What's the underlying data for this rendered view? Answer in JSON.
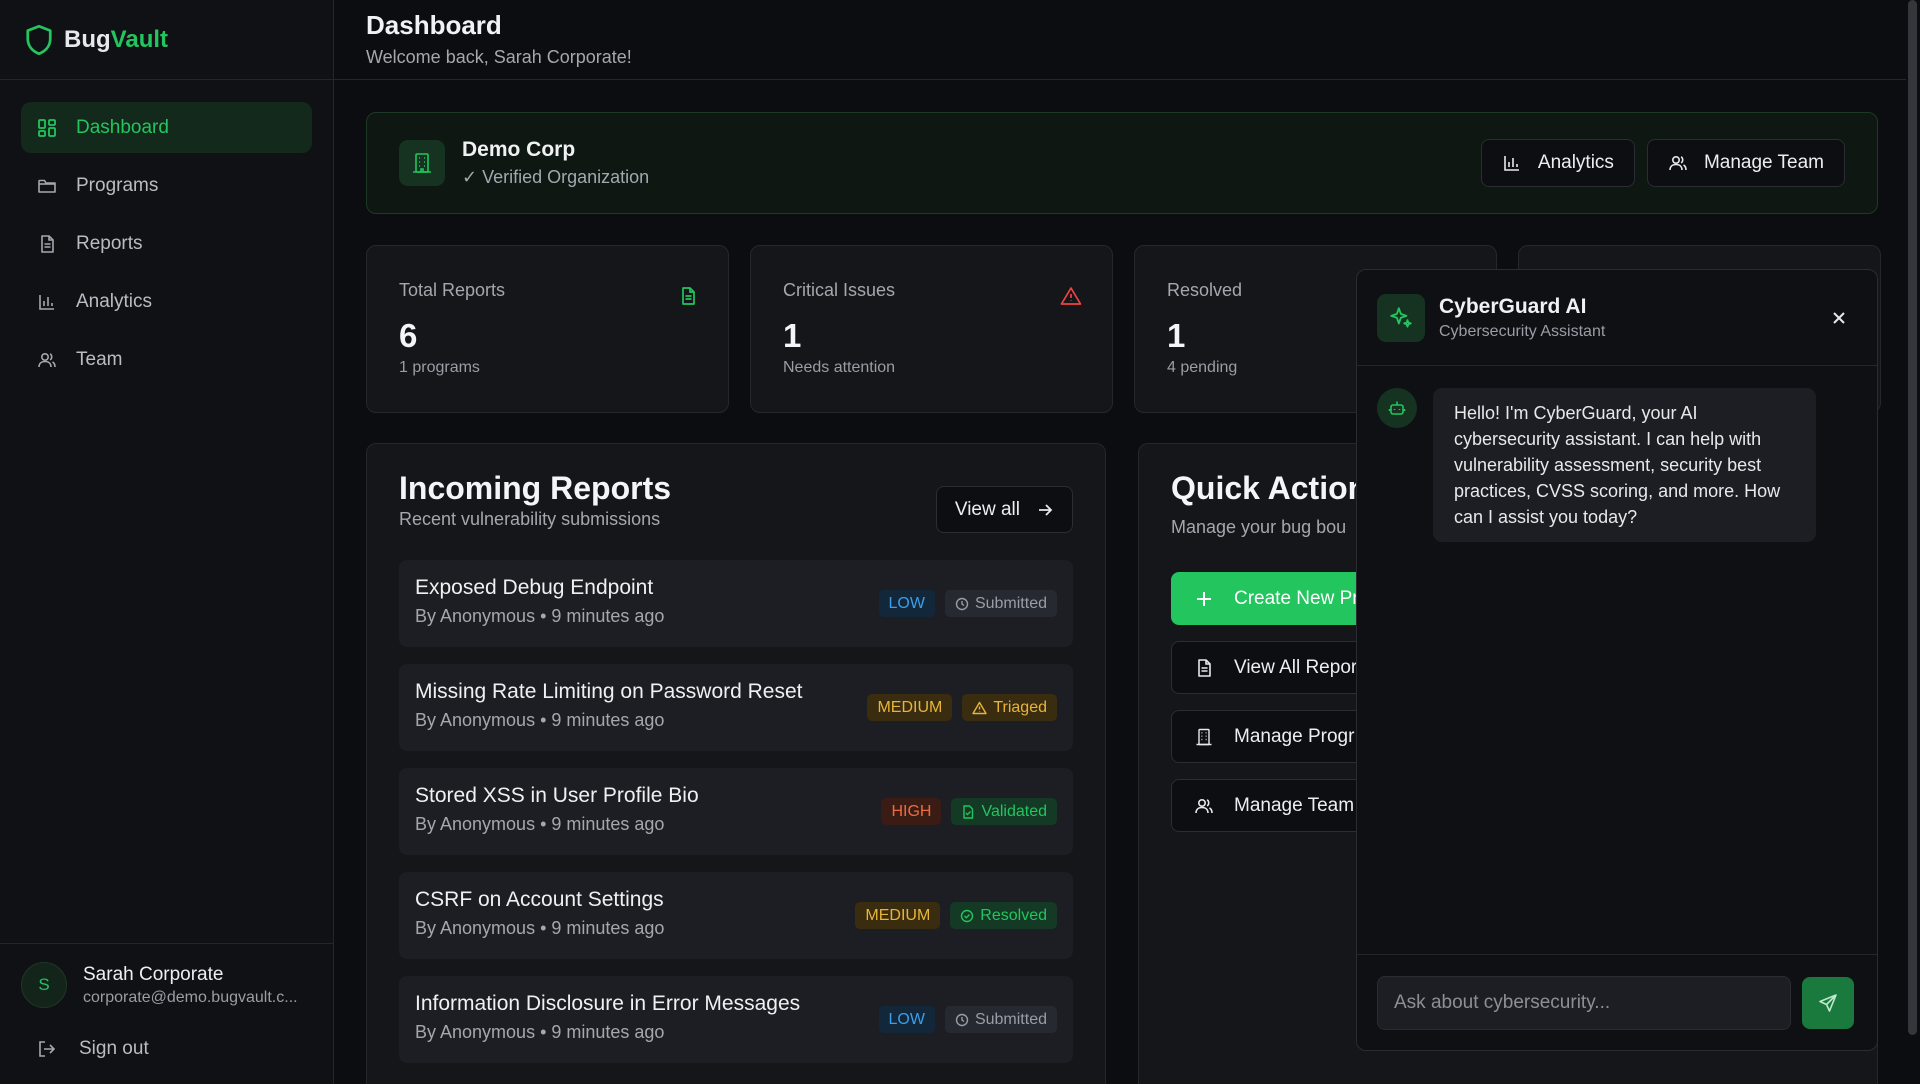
{
  "brand": {
    "part1": "Bug",
    "part2": "Vault"
  },
  "sidebar": {
    "items": [
      {
        "label": "Dashboard",
        "icon": "dashboard-icon"
      },
      {
        "label": "Programs",
        "icon": "folder-icon"
      },
      {
        "label": "Reports",
        "icon": "file-icon"
      },
      {
        "label": "Analytics",
        "icon": "bar-chart-icon"
      },
      {
        "label": "Team",
        "icon": "users-icon"
      }
    ],
    "user": {
      "initial": "S",
      "name": "Sarah Corporate",
      "email": "corporate@demo.bugvault.c..."
    },
    "signout": "Sign out"
  },
  "header": {
    "title": "Dashboard",
    "subtitle": "Welcome back, Sarah Corporate!"
  },
  "org": {
    "name": "Demo Corp",
    "verified": "✓ Verified Organization",
    "analytics_label": "Analytics",
    "manage_team_label": "Manage Team"
  },
  "stats": [
    {
      "label": "Total Reports",
      "value": "6",
      "sub": "1 programs"
    },
    {
      "label": "Critical Issues",
      "value": "1",
      "sub": "Needs attention"
    },
    {
      "label": "Resolved",
      "value": "1",
      "sub": "4 pending"
    }
  ],
  "reports": {
    "title": "Incoming Reports",
    "subtitle": "Recent vulnerability submissions",
    "view_all": "View all",
    "items": [
      {
        "title": "Exposed Debug Endpoint",
        "meta": "By Anonymous • 9 minutes ago",
        "severity": "LOW",
        "status": "Submitted"
      },
      {
        "title": "Missing Rate Limiting on Password Reset",
        "meta": "By Anonymous • 9 minutes ago",
        "severity": "MEDIUM",
        "status": "Triaged"
      },
      {
        "title": "Stored XSS in User Profile Bio",
        "meta": "By Anonymous • 9 minutes ago",
        "severity": "HIGH",
        "status": "Validated"
      },
      {
        "title": "CSRF on Account Settings",
        "meta": "By Anonymous • 9 minutes ago",
        "severity": "MEDIUM",
        "status": "Resolved"
      },
      {
        "title": "Information Disclosure in Error Messages",
        "meta": "By Anonymous • 9 minutes ago",
        "severity": "LOW",
        "status": "Submitted"
      }
    ]
  },
  "quick": {
    "title": "Quick Action",
    "subtitle": "Manage your bug bou",
    "actions": [
      {
        "label": "Create New Pr"
      },
      {
        "label": "View All Repor"
      },
      {
        "label": "Manage Progr"
      },
      {
        "label": "Manage Team"
      }
    ]
  },
  "chat": {
    "title": "CyberGuard AI",
    "subtitle": "Cybersecurity Assistant",
    "message": "Hello! I'm CyberGuard, your AI cybersecurity assistant. I can help with vulnerability assessment, security best practices, CVSS scoring, and more. How can I assist you today?",
    "placeholder": "Ask about cybersecurity..."
  },
  "colors": {
    "accent": "#22c55e",
    "background": "#0c0d10",
    "critical": "#ef4444"
  }
}
